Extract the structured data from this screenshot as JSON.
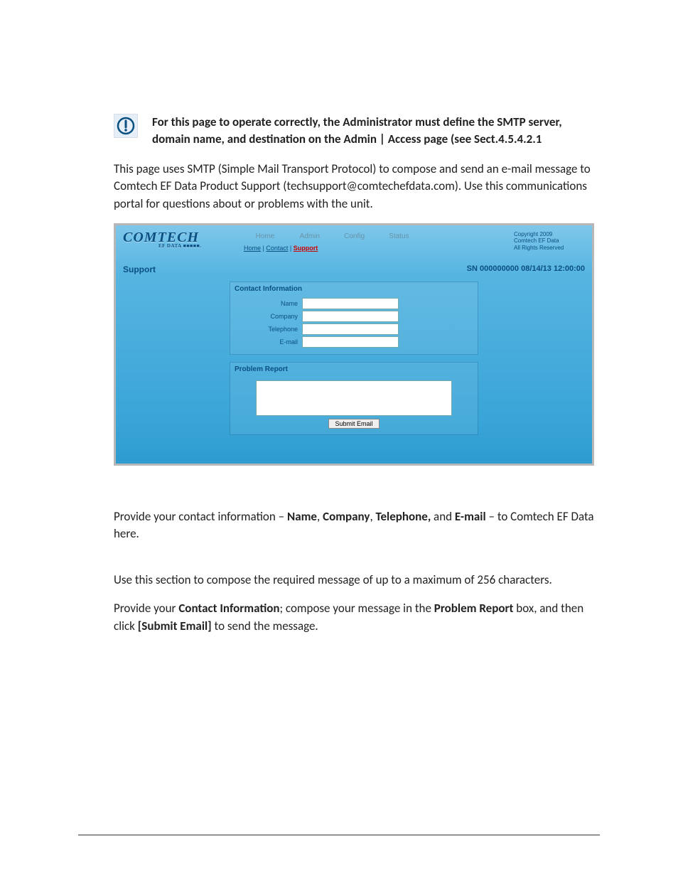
{
  "alert": {
    "text": "For this page to operate correctly, the Administrator must define the SMTP server, domain name, and destination on the Admin | Access page (see Sect.4.5.4.2.1"
  },
  "intro": "This page uses SMTP (Simple Mail Transport Protocol) to compose and send an e-mail message to Comtech EF Data Product Support (techsupport@comtechefdata.com). Use this communications portal for questions about or problems with the unit.",
  "screenshot": {
    "logo": {
      "main": "COMTECH",
      "sub": "EF DATA ■■■■■."
    },
    "nav": {
      "home": "Home",
      "admin": "Admin",
      "config": "Config",
      "status": "Status"
    },
    "subnav": {
      "home": "Home",
      "contact": "Contact",
      "support": "Support"
    },
    "copyright": {
      "l1": "Copyright 2009",
      "l2": "Comtech EF Data",
      "l3": "All Rights Reserved"
    },
    "page_title": "Support",
    "sn": "SN 000000000 08/14/13 12:00:00",
    "contact_title": "Contact Information",
    "labels": {
      "name": "Name",
      "company": "Company",
      "telephone": "Telephone",
      "email": "E-mail"
    },
    "values": {
      "name": "",
      "company": "",
      "telephone": "",
      "email": ""
    },
    "report_title": "Problem Report",
    "report_value": "",
    "submit": "Submit Email"
  },
  "para_contact_pre": "Provide your contact information – ",
  "para_contact_name": "Name",
  "para_contact_company": "Company",
  "para_contact_tel": "Telephone,",
  "para_contact_and": " and ",
  "para_contact_email": "E-mail",
  "para_contact_post": " – to Comtech EF Data here.",
  "para_compose": "Use this section to compose the required message of up to a maximum of 256 characters.",
  "para_final_1": "Provide your ",
  "para_final_ci": "Contact Information",
  "para_final_2": "; compose your message in the ",
  "para_final_pr": "Problem Report",
  "para_final_3": " box, and then click ",
  "para_final_btn": "[Submit Email]",
  "para_final_4": " to send the message."
}
